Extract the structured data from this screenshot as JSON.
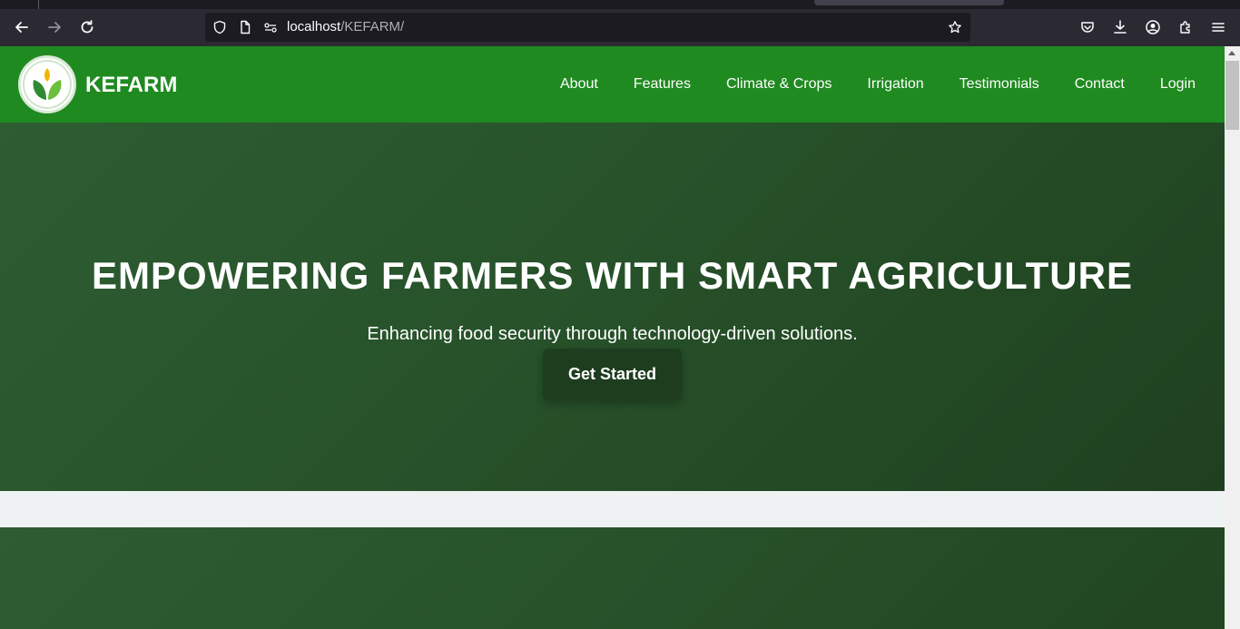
{
  "browser": {
    "url_host": "localhost",
    "url_path": "/KEFARM/",
    "icons": [
      "back-arrow-icon",
      "forward-arrow-icon",
      "reload-icon",
      "shield-icon",
      "page-icon",
      "permissions-icon",
      "star-icon",
      "pocket-icon",
      "download-icon",
      "account-icon",
      "extensions-icon",
      "menu-icon"
    ]
  },
  "site": {
    "brand": "KEFARM",
    "nav": [
      {
        "label": "About"
      },
      {
        "label": "Features"
      },
      {
        "label": "Climate & Crops"
      },
      {
        "label": "Irrigation"
      },
      {
        "label": "Testimonials"
      },
      {
        "label": "Contact"
      },
      {
        "label": "Login"
      }
    ],
    "colors": {
      "header": "#1f8a20",
      "hero_dark": "#1f401f",
      "hero_light": "#2e5d32",
      "button": "#1e3d1f"
    }
  },
  "hero": {
    "title": "EMPOWERING FARMERS WITH SMART AGRICULTURE",
    "subtitle": "Enhancing food security through technology-driven solutions.",
    "cta_label": "Get Started"
  }
}
